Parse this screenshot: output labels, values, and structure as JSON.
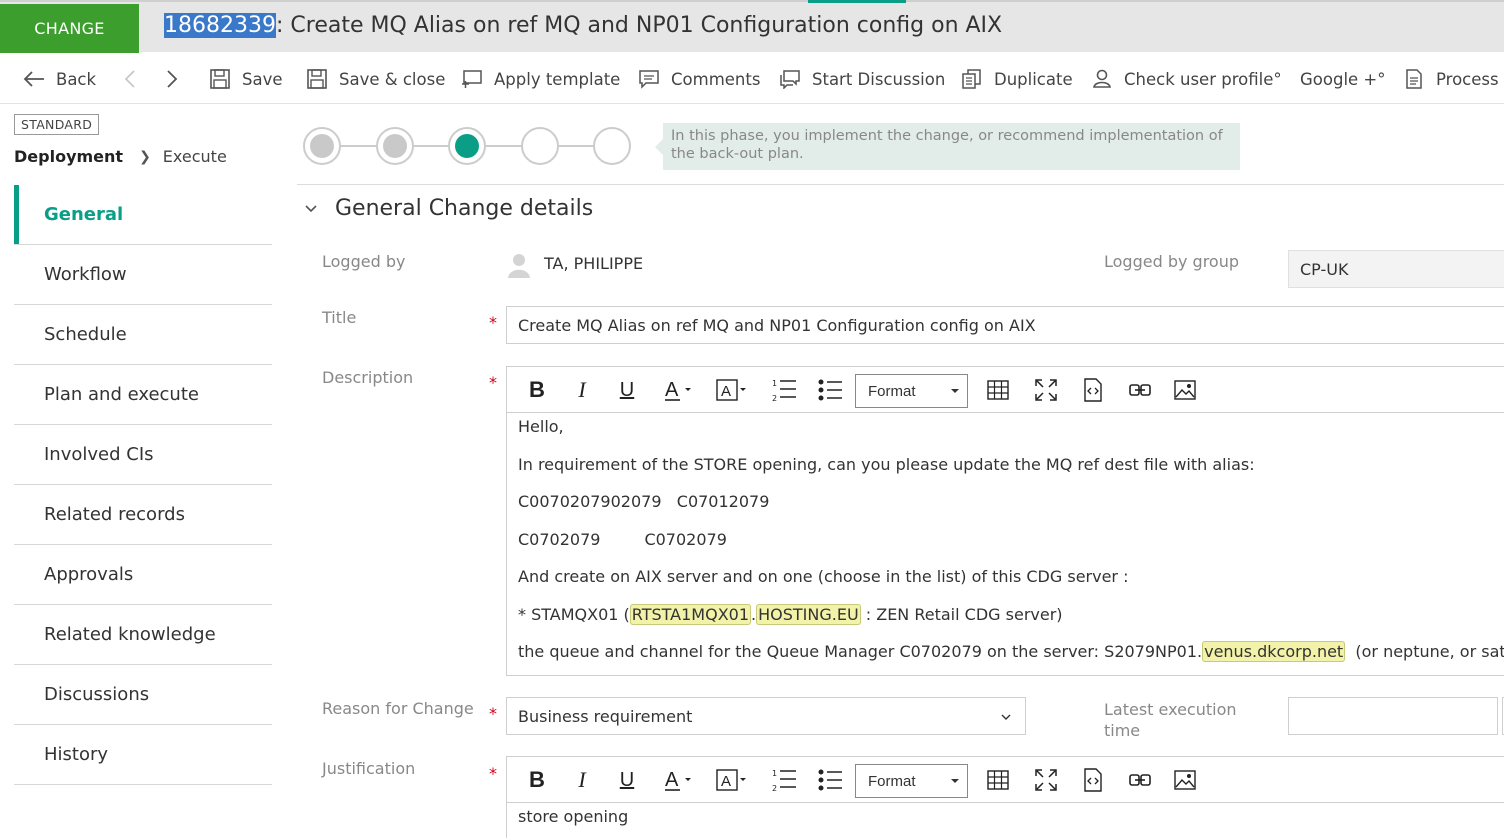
{
  "header": {
    "record_type": "CHANGE",
    "record_id": "18682339",
    "title_rest": ": Create MQ Alias on ref MQ and NP01 Configuration config on AIX"
  },
  "toolbar": {
    "back": "Back",
    "save": "Save",
    "save_close": "Save & close",
    "apply_template": "Apply template",
    "comments": "Comments",
    "start_discussion": "Start Discussion",
    "duplicate": "Duplicate",
    "check_user_profile": "Check user profile°",
    "google": "Google +°",
    "process": "Process d"
  },
  "left": {
    "badge": "STANDARD",
    "breadcrumb_phase": "Deployment",
    "breadcrumb_step": "Execute",
    "nav": [
      {
        "label": "General",
        "active": true
      },
      {
        "label": "Workflow"
      },
      {
        "label": "Schedule"
      },
      {
        "label": "Plan and execute"
      },
      {
        "label": "Involved CIs"
      },
      {
        "label": "Related records"
      },
      {
        "label": "Approvals"
      },
      {
        "label": "Related knowledge"
      },
      {
        "label": "Discussions"
      },
      {
        "label": "History"
      }
    ]
  },
  "phases": {
    "states": [
      "done",
      "done",
      "current",
      "todo",
      "todo"
    ],
    "hint": "In this phase, you implement the change, or recommend implementation of the back-out plan."
  },
  "section": {
    "title": "General Change details"
  },
  "form": {
    "logged_by_label": "Logged by",
    "logged_by_value": "TA, PHILIPPE",
    "logged_by_group_label": "Logged by group",
    "logged_by_group_value": "CP-UK",
    "title_label": "Title",
    "title_value": "Create MQ Alias on ref MQ and NP01 Configuration config on AIX",
    "description_label": "Description",
    "description": {
      "line1": "Hello,",
      "line2": "In requirement of the STORE opening, can you please update the MQ ref dest file with alias:",
      "line3": "C0070207902079   C07012079",
      "line4a": "C0702079",
      "line4b": "C0702079",
      "line5": "And create on AIX server and on one (choose in the list) of this CDG server :",
      "line6_pre": "* STAMQX01 (",
      "line6_link1": "RTSTA1MQX01",
      "line6_dot": ".",
      "line6_link2": "HOSTING.EU",
      "line6_post": " : ZEN Retail CDG server)",
      "line7_pre": "the queue and channel for the Queue Manager C0702079 on the server: S2079NP01.",
      "line7_link": "venus.dkcorp.net",
      "line7_post": "  (or neptune, or saturn)"
    },
    "reason_label": "Reason for Change",
    "reason_value": "Business requirement",
    "latest_exec_label_1": "Latest execution",
    "latest_exec_label_2": "time",
    "justification_label": "Justification",
    "justification_value": "store opening"
  },
  "editor": {
    "format_label": "Format"
  },
  "colors": {
    "brand_green": "#3c9e2d",
    "accent_teal": "#0a9e87",
    "required_red": "#d0021b",
    "selection_blue": "#3a78c9"
  }
}
